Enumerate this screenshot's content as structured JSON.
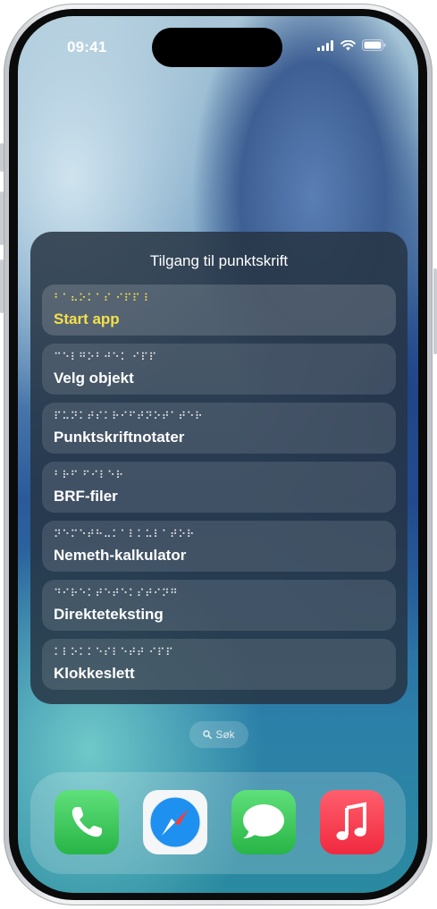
{
  "status_bar": {
    "time": "09:41"
  },
  "braille_sheet": {
    "title": "Tilgang til punktskrift",
    "items": [
      {
        "braille": "⠃⠁⠦⠕⠅⠁⠎ ⠊⠏⠏⠸",
        "label": "Start app",
        "selected": true
      },
      {
        "braille": "⠉⠑⠇⠛⠕⠃⠚⠑⠅ ⠊⠏⠏",
        "label": "Velg objekt"
      },
      {
        "braille": "⠏⠥⠝⠅⠞⠎⠅⠗⠊⠋⠞⠝⠕⠞⠁⠞⠑⠗",
        "label": "Punktskriftnotater"
      },
      {
        "braille": "⠃⠗⠋ ⠋⠊⠇⠑⠗",
        "label": "BRF-filer"
      },
      {
        "braille": "⠝⠑⠍⠑⠞⠓⠤⠅⠁⠇⠅⠥⠇⠁⠞⠕⠗",
        "label": "Nemeth-kalkulator"
      },
      {
        "braille": "⠙⠊⠗⠑⠅⠞⠑⠞⠑⠅⠎⠞⠊⠝⠛",
        "label": "Direkteteksting"
      },
      {
        "braille": "⠅⠇⠕⠅⠅⠑⠎⠇⠑⠞⠞ ⠊⠏⠏",
        "label": "Klokkeslett"
      }
    ]
  },
  "search": {
    "label": "Søk",
    "icon": "magnifying-glass-icon"
  },
  "dock": {
    "apps": [
      {
        "name": "phone",
        "color": "#34c759"
      },
      {
        "name": "safari",
        "color": "#1f8ef1"
      },
      {
        "name": "messages",
        "color": "#34c759"
      },
      {
        "name": "music",
        "color": "#fc3c44"
      }
    ]
  }
}
